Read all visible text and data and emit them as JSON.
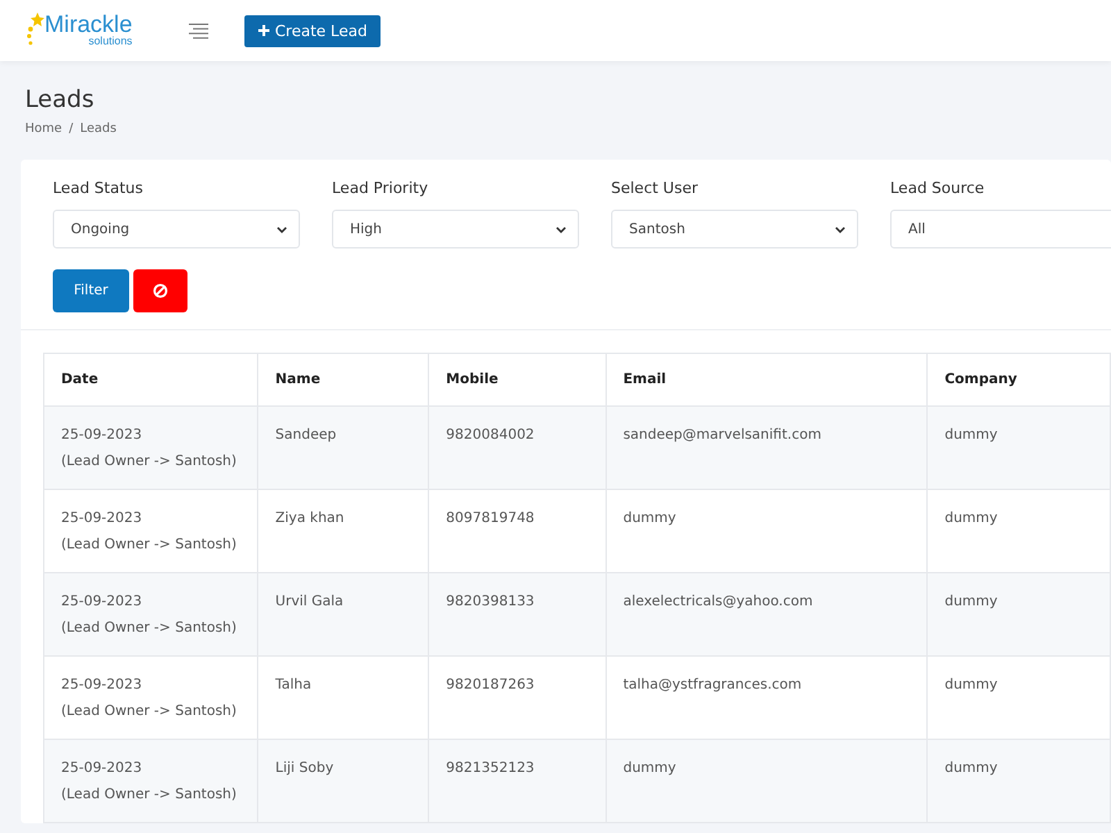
{
  "header": {
    "logo": {
      "name": "Mirackle",
      "tagline": "solutions"
    },
    "create_button": "Create Lead"
  },
  "page": {
    "title": "Leads",
    "breadcrumb": [
      "Home",
      "Leads"
    ],
    "breadcrumb_separator": "/"
  },
  "filters": [
    {
      "label": "Lead Status",
      "value": "Ongoing"
    },
    {
      "label": "Lead Priority",
      "value": "High"
    },
    {
      "label": "Select User",
      "value": "Santosh"
    },
    {
      "label": "Lead Source",
      "value": "All"
    }
  ],
  "filter_button": "Filter",
  "table": {
    "columns": [
      "Date",
      "Name",
      "Mobile",
      "Email",
      "Company"
    ],
    "rows": [
      {
        "date": "25-09-2023",
        "owner": "(Lead Owner -> Santosh)",
        "name": "Sandeep",
        "mobile": "9820084002",
        "email": "sandeep@marvelsanifit.com",
        "company": "dummy"
      },
      {
        "date": "25-09-2023",
        "owner": "(Lead Owner -> Santosh)",
        "name": "Ziya khan",
        "mobile": "8097819748",
        "email": "dummy",
        "company": "dummy"
      },
      {
        "date": "25-09-2023",
        "owner": "(Lead Owner -> Santosh)",
        "name": "Urvil Gala",
        "mobile": "9820398133",
        "email": "alexelectricals@yahoo.com",
        "company": "dummy"
      },
      {
        "date": "25-09-2023",
        "owner": "(Lead Owner -> Santosh)",
        "name": "Talha",
        "mobile": "9820187263",
        "email": "talha@ystfragrances.com",
        "company": "dummy"
      },
      {
        "date": "25-09-2023",
        "owner": "(Lead Owner -> Santosh)",
        "name": "Liji Soby",
        "mobile": "9821352123",
        "email": "dummy",
        "company": "dummy"
      }
    ]
  }
}
